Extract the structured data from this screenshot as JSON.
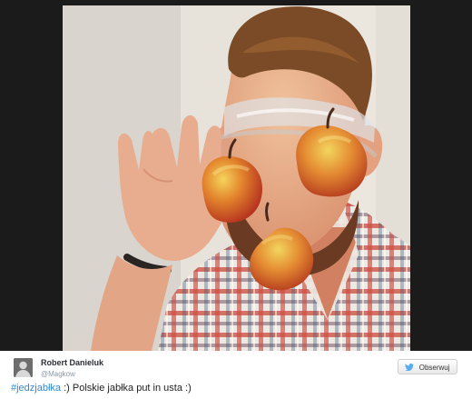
{
  "tweet": {
    "author": {
      "name": "Robert Danieluk",
      "handle": "@Magkow",
      "avatar_icon": "user-avatar-icon"
    },
    "follow_button": {
      "label": "Obserwuj",
      "icon": "twitter-bird-icon"
    },
    "text": {
      "hashtag": "#jedzjabłka",
      "body": ":) Polskie jabłka put in usta :)"
    },
    "photo": {
      "subject": "photo-of-man-with-apples-on-eyes-and-mouth"
    }
  },
  "colors": {
    "hashtag": "#2a8bd6",
    "frame": "#1b1b1b",
    "background": "#ffffff",
    "twitter_blue": "#55acee"
  }
}
